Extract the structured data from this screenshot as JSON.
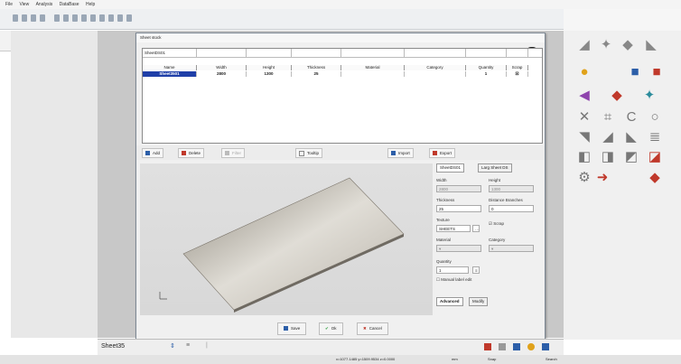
{
  "menu": [
    "File",
    "View",
    "Analysis",
    "DataBase",
    "Help"
  ],
  "dialog": {
    "title": "Sheet stock",
    "filter_value": "SheetDS01",
    "columns": [
      "Name",
      "Width",
      "Height",
      "Thickness",
      "Material",
      "Category",
      "Quantity",
      "Scrap"
    ],
    "rows": [
      {
        "name": "Sheet3501",
        "width": "2800",
        "height": "1300",
        "thickness": "25",
        "material": "",
        "category": "",
        "quantity": "1",
        "scrap": "☒"
      }
    ],
    "buttons": {
      "add": "Add",
      "delete": "Delete",
      "filter": "Filter",
      "tooltip": "Tooltip",
      "import": "Import",
      "export": "Export"
    },
    "props": {
      "tabs": [
        "SheetDS01",
        "Larg Sheet DS"
      ],
      "width_label": "Width",
      "width_value": "2800",
      "height_label": "Height",
      "height_value": "1300",
      "thickness_label": "Thickness",
      "thickness_value": "25",
      "distance_label": "Distance Branches",
      "distance_value": "0",
      "texture_label": "Texture",
      "texture_value": "SHEETS",
      "scrap_label": "Scrap",
      "material_label": "Material",
      "category_label": "Category",
      "quantity_label": "Quantity",
      "quantity_value": "1",
      "manual_label": "Manual label edit",
      "bottom_tabs": [
        "Advanced",
        "Modify"
      ]
    },
    "footer": {
      "save": "Save",
      "ok": "Ok",
      "cancel": "Cancel"
    }
  },
  "statusbar": {
    "sheet_name": "Sheet35"
  },
  "bottombar": {
    "coords": "x=1077.1485 y=1509.9534 z=0.0000",
    "unit": "mm",
    "snap": "Snap",
    "search": "Search"
  },
  "colors": {
    "accent": "#1f3fa8",
    "delete_red": "#c0392b",
    "close_bg": "#222222"
  }
}
